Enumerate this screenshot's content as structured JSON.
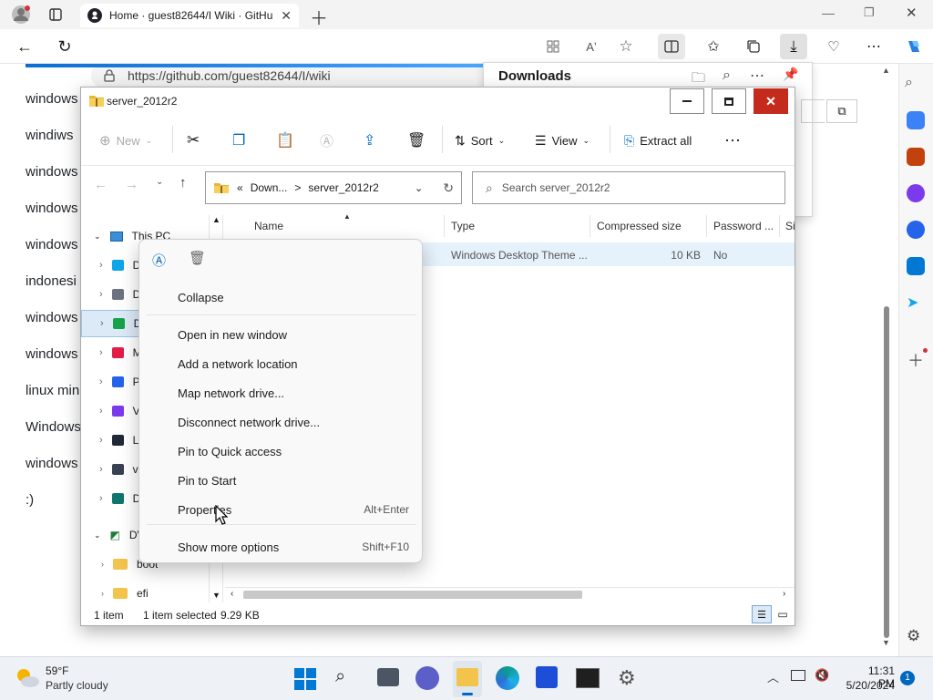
{
  "browser": {
    "tab_title": "Home · guest82644/I Wiki · GitHub",
    "url": "https://github.com/guest82644/I/wiki"
  },
  "wiki": {
    "lines": [
      "windows",
      "windiws",
      "windows",
      "windows",
      "windows",
      "indonesi",
      "windows",
      "windows",
      "linux min",
      "Windows",
      "windows",
      ":)"
    ]
  },
  "downloads": {
    "title": "Downloads"
  },
  "explorer": {
    "title": "server_2012r2",
    "toolbar": {
      "new": "New",
      "sort": "Sort",
      "view": "View",
      "extract": "Extract all"
    },
    "breadcrumb": {
      "prefix": "«",
      "part1": "Down...",
      "sep": ">",
      "part2": "server_2012r2"
    },
    "search_placeholder": "Search server_2012r2",
    "nav": {
      "this_pc": "This PC",
      "dvd": "DV",
      "boot": "boot",
      "efi": "efi",
      "partial": [
        "D",
        "D",
        "D",
        "M",
        "P",
        "V",
        "L",
        "v",
        "D"
      ]
    },
    "columns": {
      "name": "Name",
      "type": "Type",
      "compressed": "Compressed size",
      "password": "Password ...",
      "size": "Si"
    },
    "rows": [
      {
        "type": "Windows Desktop Theme ...",
        "compressed": "10 KB",
        "password": "No"
      }
    ],
    "status": {
      "count": "1 item",
      "selected": "1 item selected",
      "size": "9.29 KB"
    }
  },
  "context_menu": {
    "items": [
      {
        "label": "Collapse",
        "shortcut": ""
      },
      {
        "label": "Open in new window",
        "shortcut": ""
      },
      {
        "label": "Add a network location",
        "shortcut": ""
      },
      {
        "label": "Map network drive...",
        "shortcut": ""
      },
      {
        "label": "Disconnect network drive...",
        "shortcut": ""
      },
      {
        "label": "Pin to Quick access",
        "shortcut": ""
      },
      {
        "label": "Pin to Start",
        "shortcut": ""
      },
      {
        "label": "Properties",
        "shortcut": "Alt+Enter"
      },
      {
        "label": "Show more options",
        "shortcut": "Shift+F10"
      }
    ]
  },
  "taskbar": {
    "weather_temp": "59°F",
    "weather_desc": "Partly cloudy",
    "time": "11:31 PM",
    "date": "5/20/2024",
    "notification_count": "1"
  },
  "colors": {
    "accent": "#0067c0",
    "close_red": "#c42b1c",
    "folder": "#e8b73a"
  }
}
